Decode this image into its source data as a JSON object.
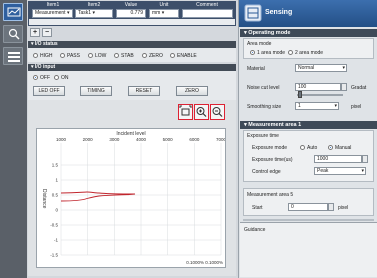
{
  "header": {
    "columns": [
      "Item1",
      "Item2",
      "Value",
      "Unit",
      "Comment"
    ],
    "row": [
      "Measurement ▾",
      "Task1 ▾",
      "0.779",
      "mm ▾",
      ""
    ]
  },
  "io_status": {
    "title": "I/O status",
    "indicators": [
      "HIGH",
      "PASS",
      "LOW",
      "STAB",
      "ZERO",
      "ENABLE"
    ]
  },
  "io_input": {
    "title": "I/O input",
    "radios": [
      "OFF",
      "ON"
    ],
    "buttons": [
      "LED OFF",
      "TIMING",
      "RESET",
      "ZERO"
    ]
  },
  "graph": {
    "xlabel": "Incident level",
    "x_ticks": [
      "1000",
      "2000",
      "3000",
      "4000",
      "5000",
      "6000",
      "7000"
    ],
    "y_ticks": [
      "1.5",
      "1",
      "0.5",
      "0",
      "-0.5",
      "-1",
      "-1.5"
    ],
    "ylabel": "Distance",
    "footer": "0.1000%  0.1000%"
  },
  "right": {
    "title": "Sensing",
    "operating_mode": {
      "title": "Operating mode",
      "area_mode_label": "Area mode",
      "area_options": [
        "1 area mode",
        "2 area mode"
      ],
      "material_label": "Material",
      "material_value": "Normal",
      "noise_cut_label": "Noise cut level",
      "noise_cut_value": "100",
      "noise_unit": "Gradat",
      "smoothing_label": "Smoothing size",
      "smoothing_value": "1",
      "smoothing_unit": "pixel"
    },
    "measurement_area": {
      "title": "Measurement area 1",
      "exposure_time_label": "Exposure time",
      "exposure_mode_label": "Exposure mode",
      "exposure_options": [
        "Auto",
        "Manual"
      ],
      "exposure_time_us_label": "Exposure time(us)",
      "exposure_time_value": "1000",
      "control_edge_label": "Control edge",
      "control_edge_value": "Peak",
      "area5_label": "Measurement area 5",
      "start_label": "Start",
      "start_value": "0",
      "start_unit": "pixel"
    },
    "guidance_label": "Guidance"
  },
  "colors": {
    "accent": "#2a5a96",
    "section_bar": "#424b56",
    "curve": "#c0242c"
  }
}
